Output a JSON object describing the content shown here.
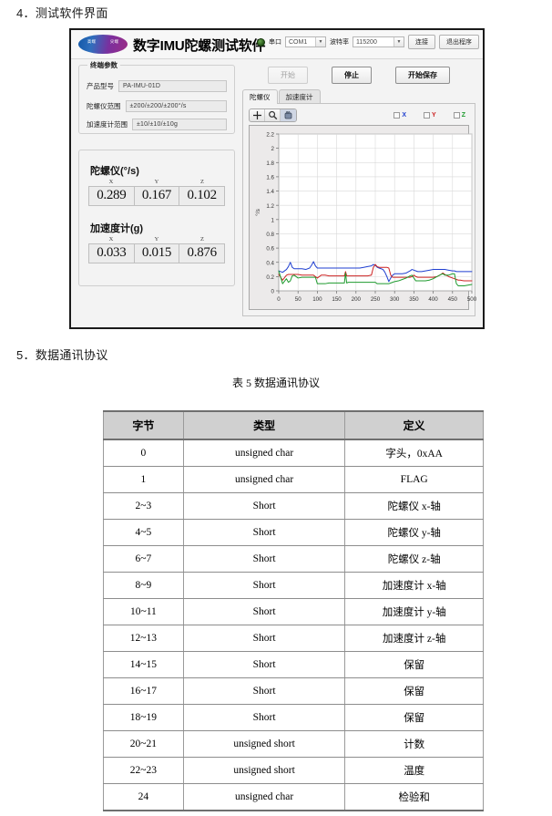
{
  "document": {
    "section4_heading": "4．测试软件界面",
    "section5_heading": "5．数据通讯协议",
    "table_caption": "表 5  数据通讯协议"
  },
  "app": {
    "title": "数字IMU陀螺测试软件",
    "logo": {
      "left_text": "高端",
      "right_text": "尖端"
    },
    "connection": {
      "led_color": "#2f7a1e",
      "port_label": "串口",
      "port_value": "COM1",
      "baud_label": "波特率",
      "baud_value": "115200",
      "connect_button": "连接",
      "exit_button": "退出程序"
    },
    "commands": {
      "start": "开始",
      "stop": "停止",
      "start_save": "开始保存"
    },
    "params_group": {
      "title": "终端参数",
      "rows": [
        {
          "label": "产品型号",
          "value": "PA-IMU-01D"
        },
        {
          "label": "陀螺仪范围",
          "value": "±200/±200/±200°/s"
        },
        {
          "label": "加速度计范围",
          "value": "±10/±10/±10g"
        }
      ]
    },
    "readout": {
      "gyro": {
        "title": "陀螺仪(°/s)",
        "axes": [
          "X",
          "Y",
          "Z"
        ],
        "values": [
          "0.289",
          "0.167",
          "0.102"
        ]
      },
      "accel": {
        "title": "加速度计(g)",
        "axes": [
          "X",
          "Y",
          "Z"
        ],
        "values": [
          "0.033",
          "0.015",
          "0.876"
        ]
      }
    },
    "tabs": [
      {
        "label": "陀螺仪",
        "active": true
      },
      {
        "label": "加速度计",
        "active": false
      }
    ],
    "graph_toolbar": {
      "cursor_icon": "crosshair-icon",
      "zoom_icon": "magnifier-icon",
      "pan_icon": "hand-pan-icon"
    },
    "legend": [
      {
        "label": "X",
        "color": "#1f3fd0"
      },
      {
        "label": "Y",
        "color": "#cc2222"
      },
      {
        "label": "Z",
        "color": "#1f9b2f"
      }
    ]
  },
  "chart_data": {
    "type": "line",
    "title": "",
    "xlabel": "",
    "ylabel": "°/s",
    "xlim": [
      0,
      500
    ],
    "ylim": [
      0,
      2.2
    ],
    "grid": true,
    "legend_position": "top-right",
    "xticks": [
      0,
      50,
      100,
      150,
      200,
      250,
      300,
      350,
      400,
      450,
      500
    ],
    "yticks": [
      0,
      0.2,
      0.4,
      0.6,
      0.8,
      1,
      1.2,
      1.4,
      1.6,
      1.8,
      2,
      2.2
    ],
    "x": [
      0,
      10,
      20,
      25,
      30,
      35,
      40,
      50,
      60,
      70,
      80,
      85,
      90,
      95,
      100,
      110,
      120,
      130,
      140,
      150,
      160,
      170,
      173,
      176,
      180,
      190,
      200,
      210,
      220,
      230,
      240,
      245,
      250,
      255,
      260,
      265,
      270,
      275,
      280,
      285,
      290,
      295,
      300,
      310,
      320,
      330,
      340,
      345,
      350,
      355,
      360,
      370,
      380,
      390,
      400,
      410,
      420,
      425,
      430,
      440,
      450,
      455,
      460,
      465,
      470,
      480,
      490,
      500
    ],
    "series": [
      {
        "name": "X",
        "color": "#1f3fd0",
        "values": [
          0.28,
          0.26,
          0.3,
          0.34,
          0.4,
          0.33,
          0.31,
          0.31,
          0.31,
          0.3,
          0.32,
          0.36,
          0.41,
          0.35,
          0.32,
          0.32,
          0.32,
          0.32,
          0.32,
          0.32,
          0.32,
          0.32,
          0.32,
          0.32,
          0.32,
          0.32,
          0.32,
          0.32,
          0.33,
          0.34,
          0.35,
          0.37,
          0.36,
          0.33,
          0.32,
          0.31,
          0.3,
          0.26,
          0.2,
          0.13,
          0.18,
          0.22,
          0.24,
          0.24,
          0.24,
          0.25,
          0.28,
          0.3,
          0.29,
          0.28,
          0.27,
          0.27,
          0.28,
          0.29,
          0.3,
          0.3,
          0.3,
          0.3,
          0.3,
          0.29,
          0.28,
          0.28,
          0.27,
          0.27,
          0.27,
          0.27,
          0.27,
          0.27
        ]
      },
      {
        "name": "Y",
        "color": "#cc2222",
        "values": [
          0.23,
          0.15,
          0.22,
          0.23,
          0.23,
          0.23,
          0.23,
          0.23,
          0.22,
          0.22,
          0.22,
          0.22,
          0.22,
          0.2,
          0.18,
          0.22,
          0.22,
          0.21,
          0.21,
          0.21,
          0.21,
          0.21,
          0.27,
          0.21,
          0.21,
          0.21,
          0.21,
          0.21,
          0.21,
          0.21,
          0.22,
          0.33,
          0.37,
          0.34,
          0.33,
          0.33,
          0.33,
          0.33,
          0.33,
          0.32,
          0.22,
          0.19,
          0.19,
          0.19,
          0.19,
          0.19,
          0.19,
          0.2,
          0.22,
          0.2,
          0.19,
          0.19,
          0.19,
          0.19,
          0.19,
          0.2,
          0.23,
          0.25,
          0.23,
          0.2,
          0.18,
          0.17,
          0.16,
          0.15,
          0.15,
          0.14,
          0.14,
          0.14
        ]
      },
      {
        "name": "Z",
        "color": "#1f9b2f",
        "values": [
          0.28,
          0.1,
          0.17,
          0.12,
          0.14,
          0.21,
          0.22,
          0.18,
          0.19,
          0.19,
          0.19,
          0.19,
          0.19,
          0.19,
          0.1,
          0.1,
          0.1,
          0.11,
          0.11,
          0.11,
          0.11,
          0.11,
          0.25,
          0.11,
          0.12,
          0.12,
          0.12,
          0.12,
          0.12,
          0.12,
          0.12,
          0.12,
          0.12,
          0.1,
          0.1,
          0.1,
          0.1,
          0.1,
          0.1,
          0.1,
          0.11,
          0.12,
          0.13,
          0.14,
          0.16,
          0.18,
          0.21,
          0.22,
          0.18,
          0.14,
          0.14,
          0.14,
          0.14,
          0.15,
          0.17,
          0.2,
          0.23,
          0.24,
          0.22,
          0.22,
          0.24,
          0.24,
          0.1,
          0.07,
          0.07,
          0.07,
          0.08,
          0.09
        ]
      }
    ]
  },
  "table": {
    "headers": [
      "字节",
      "类型",
      "定义"
    ],
    "rows": [
      [
        "0",
        "unsigned char",
        "字头，0xAA"
      ],
      [
        "1",
        "unsigned char",
        "FLAG"
      ],
      [
        "2~3",
        "Short",
        "陀螺仪 x-轴"
      ],
      [
        "4~5",
        "Short",
        "陀螺仪 y-轴"
      ],
      [
        "6~7",
        "Short",
        "陀螺仪 z-轴"
      ],
      [
        "8~9",
        "Short",
        "加速度计 x-轴"
      ],
      [
        "10~11",
        "Short",
        "加速度计 y-轴"
      ],
      [
        "12~13",
        "Short",
        "加速度计 z-轴"
      ],
      [
        "14~15",
        "Short",
        "保留"
      ],
      [
        "16~17",
        "Short",
        "保留"
      ],
      [
        "18~19",
        "Short",
        "保留"
      ],
      [
        "20~21",
        "unsigned short",
        "计数"
      ],
      [
        "22~23",
        "unsigned short",
        "温度"
      ],
      [
        "24",
        "unsigned char",
        "检验和"
      ]
    ]
  }
}
